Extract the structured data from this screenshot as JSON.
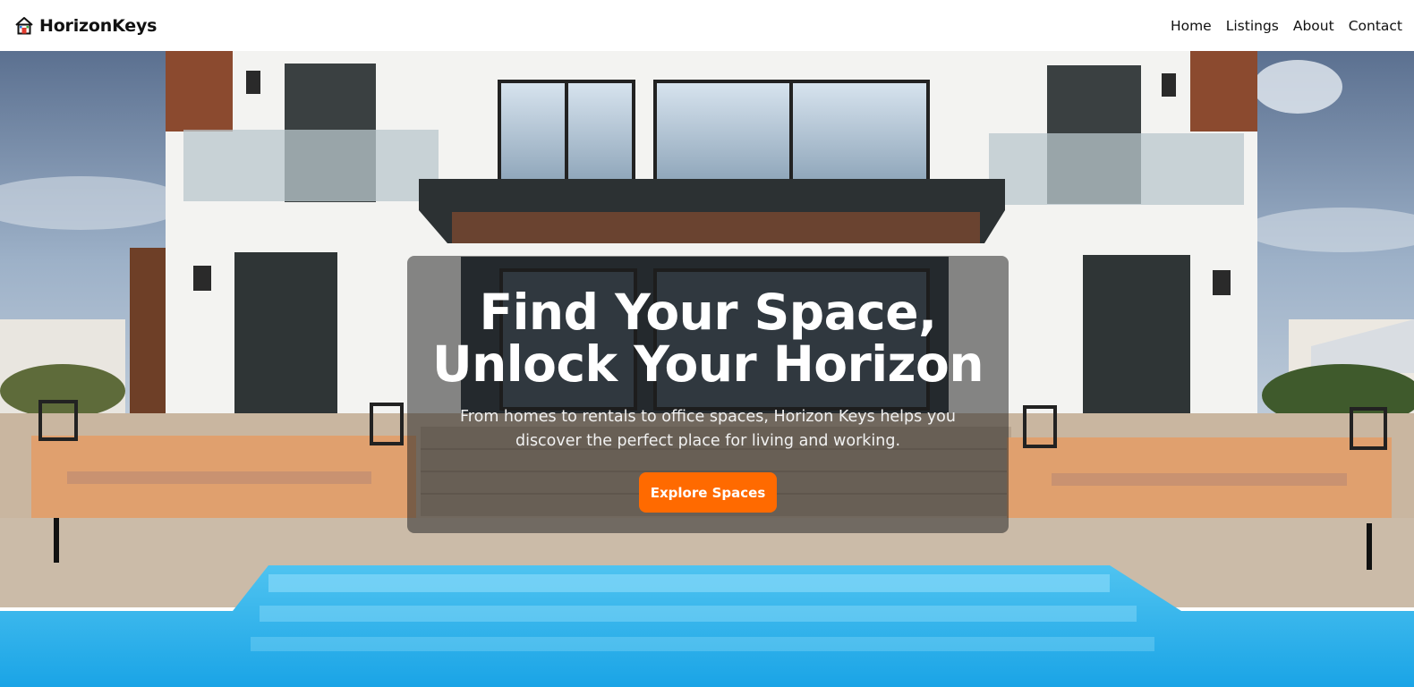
{
  "nav": {
    "brand": "HorizonKeys",
    "brand_icon": "house-icon",
    "links": [
      "Home",
      "Listings",
      "About",
      "Contact"
    ]
  },
  "hero": {
    "background": "modern-villa-with-pool-photo",
    "title_line1": "Find Your Space,",
    "title_line2": "Unlock Your Horizon",
    "subtitle": "From homes to rentals to office spaces, Horizon Keys helps you discover the perfect place for living and working.",
    "cta_label": "Explore Spaces"
  },
  "colors": {
    "accent": "#ff6a00",
    "overlay": "#282828"
  }
}
